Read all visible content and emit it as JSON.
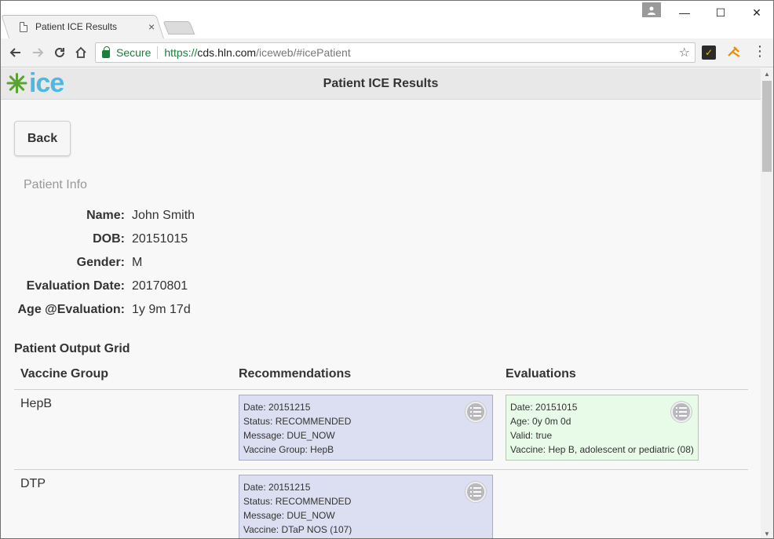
{
  "browser": {
    "tab_title": "Patient ICE Results",
    "tab_close": "×",
    "minimize": "—",
    "maximize": "☐",
    "close": "✕",
    "secure_label": "Secure",
    "url_scheme": "https://",
    "url_host": "cds.hln.com",
    "url_path": "/iceweb/#icePatient",
    "icons": [
      "back-arrow-icon",
      "forward-arrow-icon",
      "reload-icon",
      "home-icon",
      "star-icon",
      "menu-icon"
    ]
  },
  "header": {
    "logo_text": "ice",
    "title": "Patient ICE Results"
  },
  "back_button": "Back",
  "patient_info": {
    "section_label": "Patient Info",
    "rows": [
      {
        "label": "Name:",
        "value": "John Smith"
      },
      {
        "label": "DOB:",
        "value": "20151015"
      },
      {
        "label": "Gender:",
        "value": "M"
      },
      {
        "label": "Evaluation Date:",
        "value": "20170801"
      },
      {
        "label": "Age @Evaluation:",
        "value": "1y 9m 17d"
      }
    ]
  },
  "grid": {
    "title": "Patient Output Grid",
    "columns": [
      "Vaccine Group",
      "Recommendations",
      "Evaluations"
    ],
    "rows": [
      {
        "group": "HepB",
        "recommendation": [
          "Date: 20151215",
          "Status: RECOMMENDED",
          "Message: DUE_NOW",
          "Vaccine Group: HepB"
        ],
        "evaluation": [
          "Date: 20151015",
          "Age: 0y 0m 0d",
          "Valid: true",
          "Vaccine: Hep B, adolescent or pediatric (08)"
        ]
      },
      {
        "group": "DTP",
        "recommendation": [
          "Date: 20151215",
          "Status: RECOMMENDED",
          "Message: DUE_NOW",
          "Vaccine: DTaP NOS (107)"
        ]
      }
    ]
  },
  "colors": {
    "recommendation_bg": "#dcdff2",
    "evaluation_bg": "#e8fae8",
    "logo_blue": "#4fb8e0",
    "logo_green": "#5aa331",
    "secure_green": "#188038"
  }
}
